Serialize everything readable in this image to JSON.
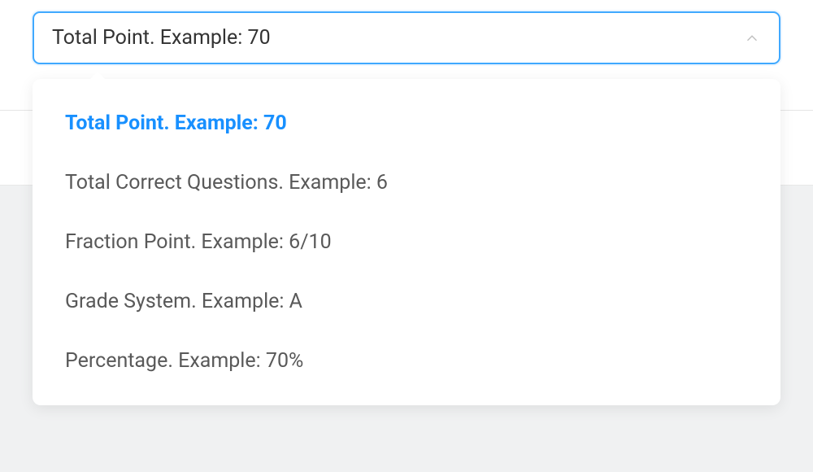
{
  "select": {
    "value": "Total Point. Example: 70"
  },
  "options": [
    {
      "label": "Total Point. Example: 70",
      "selected": true
    },
    {
      "label": "Total Correct Questions. Example: 6",
      "selected": false
    },
    {
      "label": "Fraction Point. Example: 6/10",
      "selected": false
    },
    {
      "label": "Grade System. Example: A",
      "selected": false
    },
    {
      "label": "Percentage. Example: 70%",
      "selected": false
    }
  ]
}
